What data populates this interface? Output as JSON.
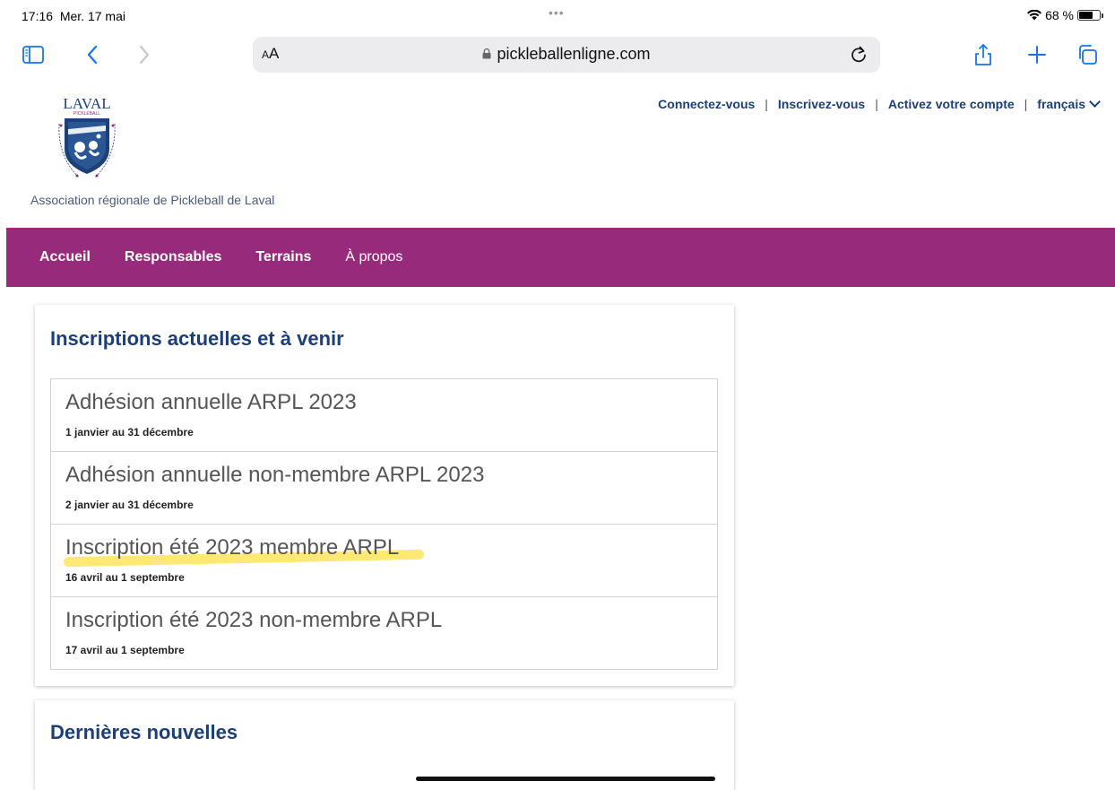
{
  "status": {
    "time": "17:16",
    "date": "Mer. 17 mai",
    "dots": "•••",
    "battery_text": "68 %",
    "battery_level": 0.68
  },
  "safari": {
    "aa_label_small": "A",
    "aa_label_big": "A",
    "url": "pickleballenligne.com"
  },
  "site": {
    "association_name": "Association régionale de Pickleball de Laval",
    "logo_text": "LAVAL",
    "logo_subtext": "PICKLEBALL",
    "top_links": {
      "login": "Connectez-vous",
      "register": "Inscrivez-vous",
      "activate": "Activez votre compte",
      "language": "français",
      "separator": "|"
    },
    "nav": [
      "Accueil",
      "Responsables",
      "Terrains",
      "À propos"
    ]
  },
  "registrations": {
    "title": "Inscriptions actuelles et à venir",
    "items": [
      {
        "title": "Adhésion annuelle ARPL 2023",
        "dates": "1 janvier au 31 décembre"
      },
      {
        "title": "Adhésion annuelle non-membre ARPL 2023",
        "dates": "2 janvier au 31 décembre"
      },
      {
        "title": "Inscription été 2023 membre ARPL",
        "dates": "16 avril au 1 septembre"
      },
      {
        "title": "Inscription été 2023 non-membre ARPL",
        "dates": "17 avril au 1 septembre"
      }
    ]
  },
  "news": {
    "title": "Dernières nouvelles"
  },
  "colors": {
    "nav_bg": "#982a7b",
    "link_blue": "#1d3f78",
    "safari_blue": "#1a73e8",
    "highlight": "#ffd600"
  }
}
